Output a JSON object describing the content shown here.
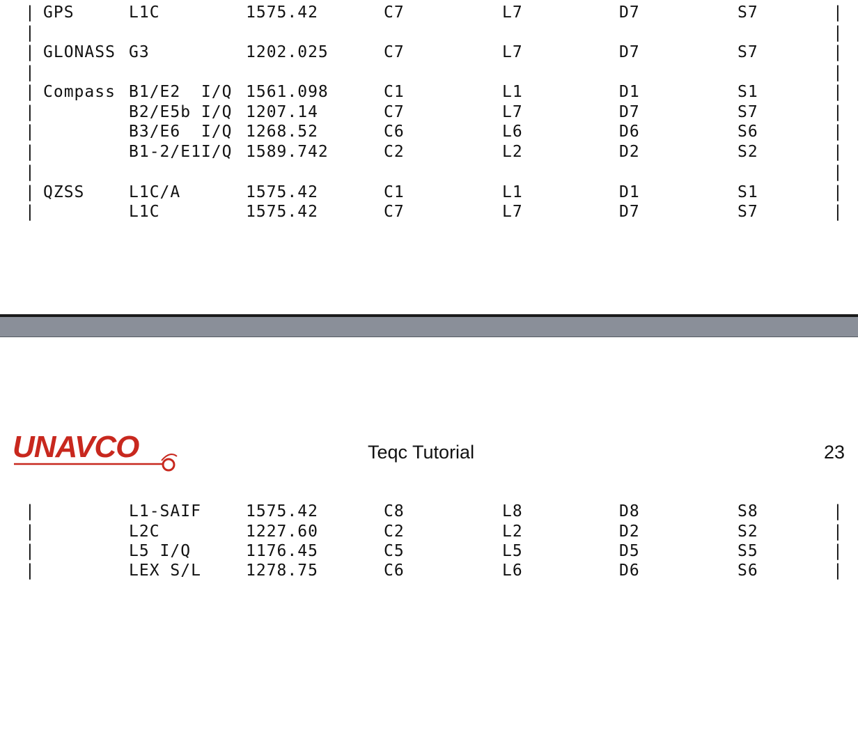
{
  "top_table": {
    "rows": [
      {
        "system": "GPS",
        "band": "L1C",
        "freq": "1575.42",
        "code": "C7",
        "phase": "L7",
        "doppler": "D7",
        "snr": "S7"
      },
      {
        "system": "",
        "band": "",
        "freq": "",
        "code": "",
        "phase": "",
        "doppler": "",
        "snr": ""
      },
      {
        "system": "GLONASS",
        "band": "G3",
        "freq": "1202.025",
        "code": "C7",
        "phase": "L7",
        "doppler": "D7",
        "snr": "S7"
      },
      {
        "system": "",
        "band": "",
        "freq": "",
        "code": "",
        "phase": "",
        "doppler": "",
        "snr": ""
      },
      {
        "system": "Compass",
        "band": "B1/E2  I/Q",
        "freq": "1561.098",
        "code": "C1",
        "phase": "L1",
        "doppler": "D1",
        "snr": "S1"
      },
      {
        "system": "",
        "band": "B2/E5b I/Q",
        "freq": "1207.14",
        "code": "C7",
        "phase": "L7",
        "doppler": "D7",
        "snr": "S7"
      },
      {
        "system": "",
        "band": "B3/E6  I/Q",
        "freq": "1268.52",
        "code": "C6",
        "phase": "L6",
        "doppler": "D6",
        "snr": "S6"
      },
      {
        "system": "",
        "band": "B1-2/E1I/Q",
        "freq": "1589.742",
        "code": "C2",
        "phase": "L2",
        "doppler": "D2",
        "snr": "S2"
      },
      {
        "system": "",
        "band": "",
        "freq": "",
        "code": "",
        "phase": "",
        "doppler": "",
        "snr": ""
      },
      {
        "system": "QZSS",
        "band": "L1C/A",
        "freq": "1575.42",
        "code": "C1",
        "phase": "L1",
        "doppler": "D1",
        "snr": "S1"
      },
      {
        "system": "",
        "band": "L1C",
        "freq": "1575.42",
        "code": "C7",
        "phase": "L7",
        "doppler": "D7",
        "snr": "S7"
      }
    ]
  },
  "footer": {
    "logo_text": "UNAVCO",
    "title": "Teqc Tutorial",
    "page_number": "23"
  },
  "bottom_table": {
    "rows": [
      {
        "system": "",
        "band": "L1-SAIF",
        "freq": "1575.42",
        "code": "C8",
        "phase": "L8",
        "doppler": "D8",
        "snr": "S8"
      },
      {
        "system": "",
        "band": "L2C",
        "freq": "1227.60",
        "code": "C2",
        "phase": "L2",
        "doppler": "D2",
        "snr": "S2"
      },
      {
        "system": "",
        "band": "L5 I/Q",
        "freq": "1176.45",
        "code": "C5",
        "phase": "L5",
        "doppler": "D5",
        "snr": "S5"
      },
      {
        "system": "",
        "band": "LEX S/L",
        "freq": "1278.75",
        "code": "C6",
        "phase": "L6",
        "doppler": "D6",
        "snr": "S6"
      }
    ]
  },
  "colors": {
    "logo_red": "#c8281e",
    "divider_gray": "#8a8f99"
  },
  "glyphs": {
    "border": "|"
  }
}
